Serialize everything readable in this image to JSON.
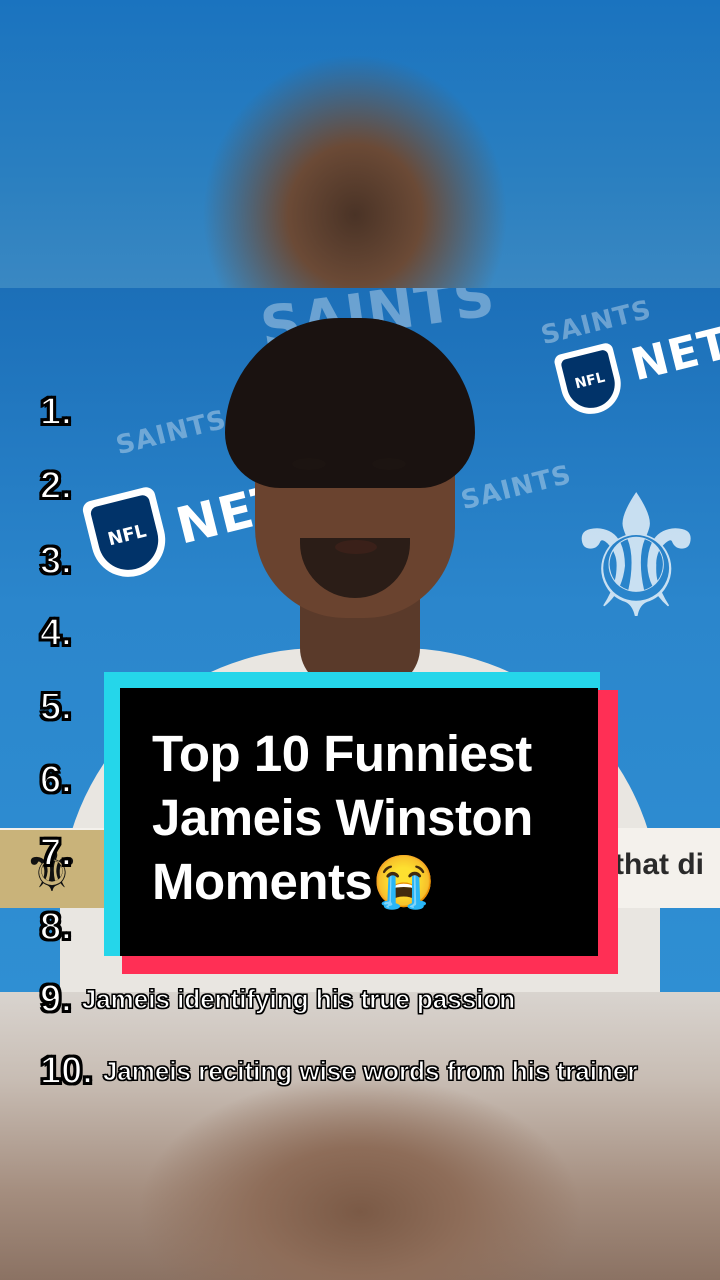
{
  "title_card": {
    "line1": "Top 10 Funniest",
    "line2": "Jameis Winston",
    "line3": "Moments😭"
  },
  "ranks": [
    {
      "num": "1.",
      "text": ""
    },
    {
      "num": "2.",
      "text": ""
    },
    {
      "num": "3.",
      "text": ""
    },
    {
      "num": "4.",
      "text": ""
    },
    {
      "num": "5.",
      "text": ""
    },
    {
      "num": "6.",
      "text": ""
    },
    {
      "num": "7.",
      "text": ""
    },
    {
      "num": "8.",
      "text": ""
    },
    {
      "num": "9.",
      "text": "Jameis identifying his true passion"
    },
    {
      "num": "10.",
      "text": "Jameis reciting wise words from his trainer"
    }
  ],
  "background": {
    "logo_text_1": "SAINTS",
    "logo_text_2": "NETW",
    "nfl_badge": "NFL",
    "lower_third_text": "that di",
    "fleur_glyph": "⚜"
  },
  "colors": {
    "card_bg": "#000000",
    "card_cyan": "#25d6ea",
    "card_pink": "#ff2f55",
    "backdrop_blue": "#1f77bb"
  }
}
